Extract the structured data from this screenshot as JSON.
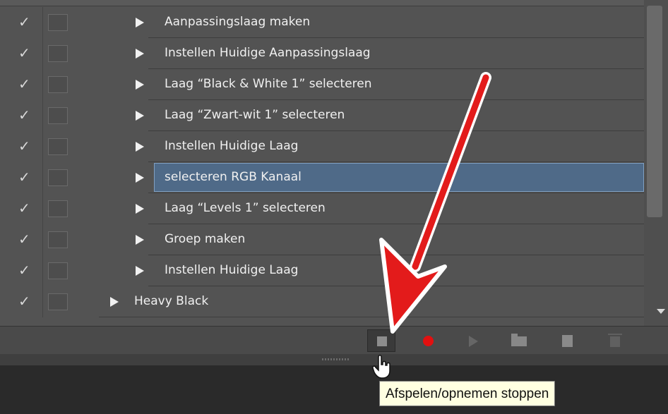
{
  "actions_panel": {
    "items": [
      {
        "label": "Aanpassingslaag maken",
        "checked": true,
        "level": 2,
        "selected": false
      },
      {
        "label": "Instellen  Huidige Aanpassingslaag",
        "checked": true,
        "level": 2,
        "selected": false
      },
      {
        "label": "Laag “Black & White 1” selecteren",
        "checked": true,
        "level": 2,
        "selected": false
      },
      {
        "label": "Laag “Zwart-wit 1” selecteren",
        "checked": true,
        "level": 2,
        "selected": false
      },
      {
        "label": "Instellen  Huidige Laag",
        "checked": true,
        "level": 2,
        "selected": false
      },
      {
        "label": "selecteren  RGB Kanaal",
        "checked": true,
        "level": 2,
        "selected": true
      },
      {
        "label": "Laag “Levels 1” selecteren",
        "checked": true,
        "level": 2,
        "selected": false
      },
      {
        "label": "Groep maken",
        "checked": true,
        "level": 2,
        "selected": false
      },
      {
        "label": "Instellen  Huidige Laag",
        "checked": true,
        "level": 2,
        "selected": false
      },
      {
        "label": "Heavy Black",
        "checked": true,
        "level": 1,
        "selected": false
      }
    ]
  },
  "toolbar": {
    "buttons": [
      "stop-playing-recording",
      "begin-recording",
      "play-selection",
      "create-new-set",
      "create-new-action",
      "delete"
    ],
    "record_color": "#e21010"
  },
  "tooltip": {
    "text": "Afspelen/opnemen stoppen"
  },
  "colors": {
    "panel_bg": "#535353",
    "selection_bg": "#4f6a88",
    "annotation_arrow": "#e31b1b"
  }
}
